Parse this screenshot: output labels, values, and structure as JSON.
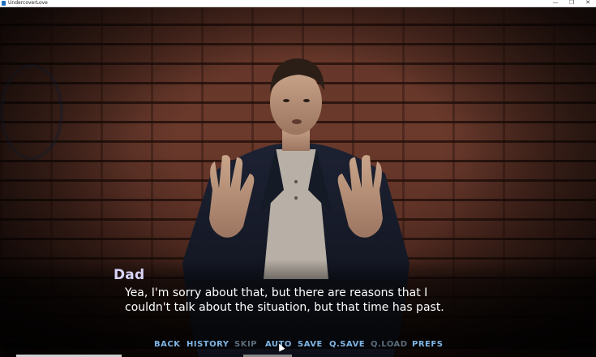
{
  "window": {
    "title": "UndercoverLove",
    "minimize_glyph": "—",
    "maximize_glyph": "❐",
    "close_glyph": "✕"
  },
  "dialogue": {
    "speaker": "Dad",
    "text": "Yea, I'm sorry about that, but there are reasons that I\ncouldn't talk about the situation, but that time has past."
  },
  "quick_menu": {
    "back": "BACK",
    "history": "HISTORY",
    "skip": "SKIP",
    "auto": "AUTO",
    "save": "SAVE",
    "qsave": "Q.SAVE",
    "qload": "Q.LOAD",
    "prefs": "PREFS"
  },
  "colors": {
    "speaker_name": "#d8d4f8",
    "menu_active": "#7fb6e6",
    "menu_disabled": "#5b6c7a",
    "dialogue_text": "#ffffff"
  },
  "icons": {
    "app": "app-icon",
    "cursor": "mouse-cursor-icon"
  }
}
